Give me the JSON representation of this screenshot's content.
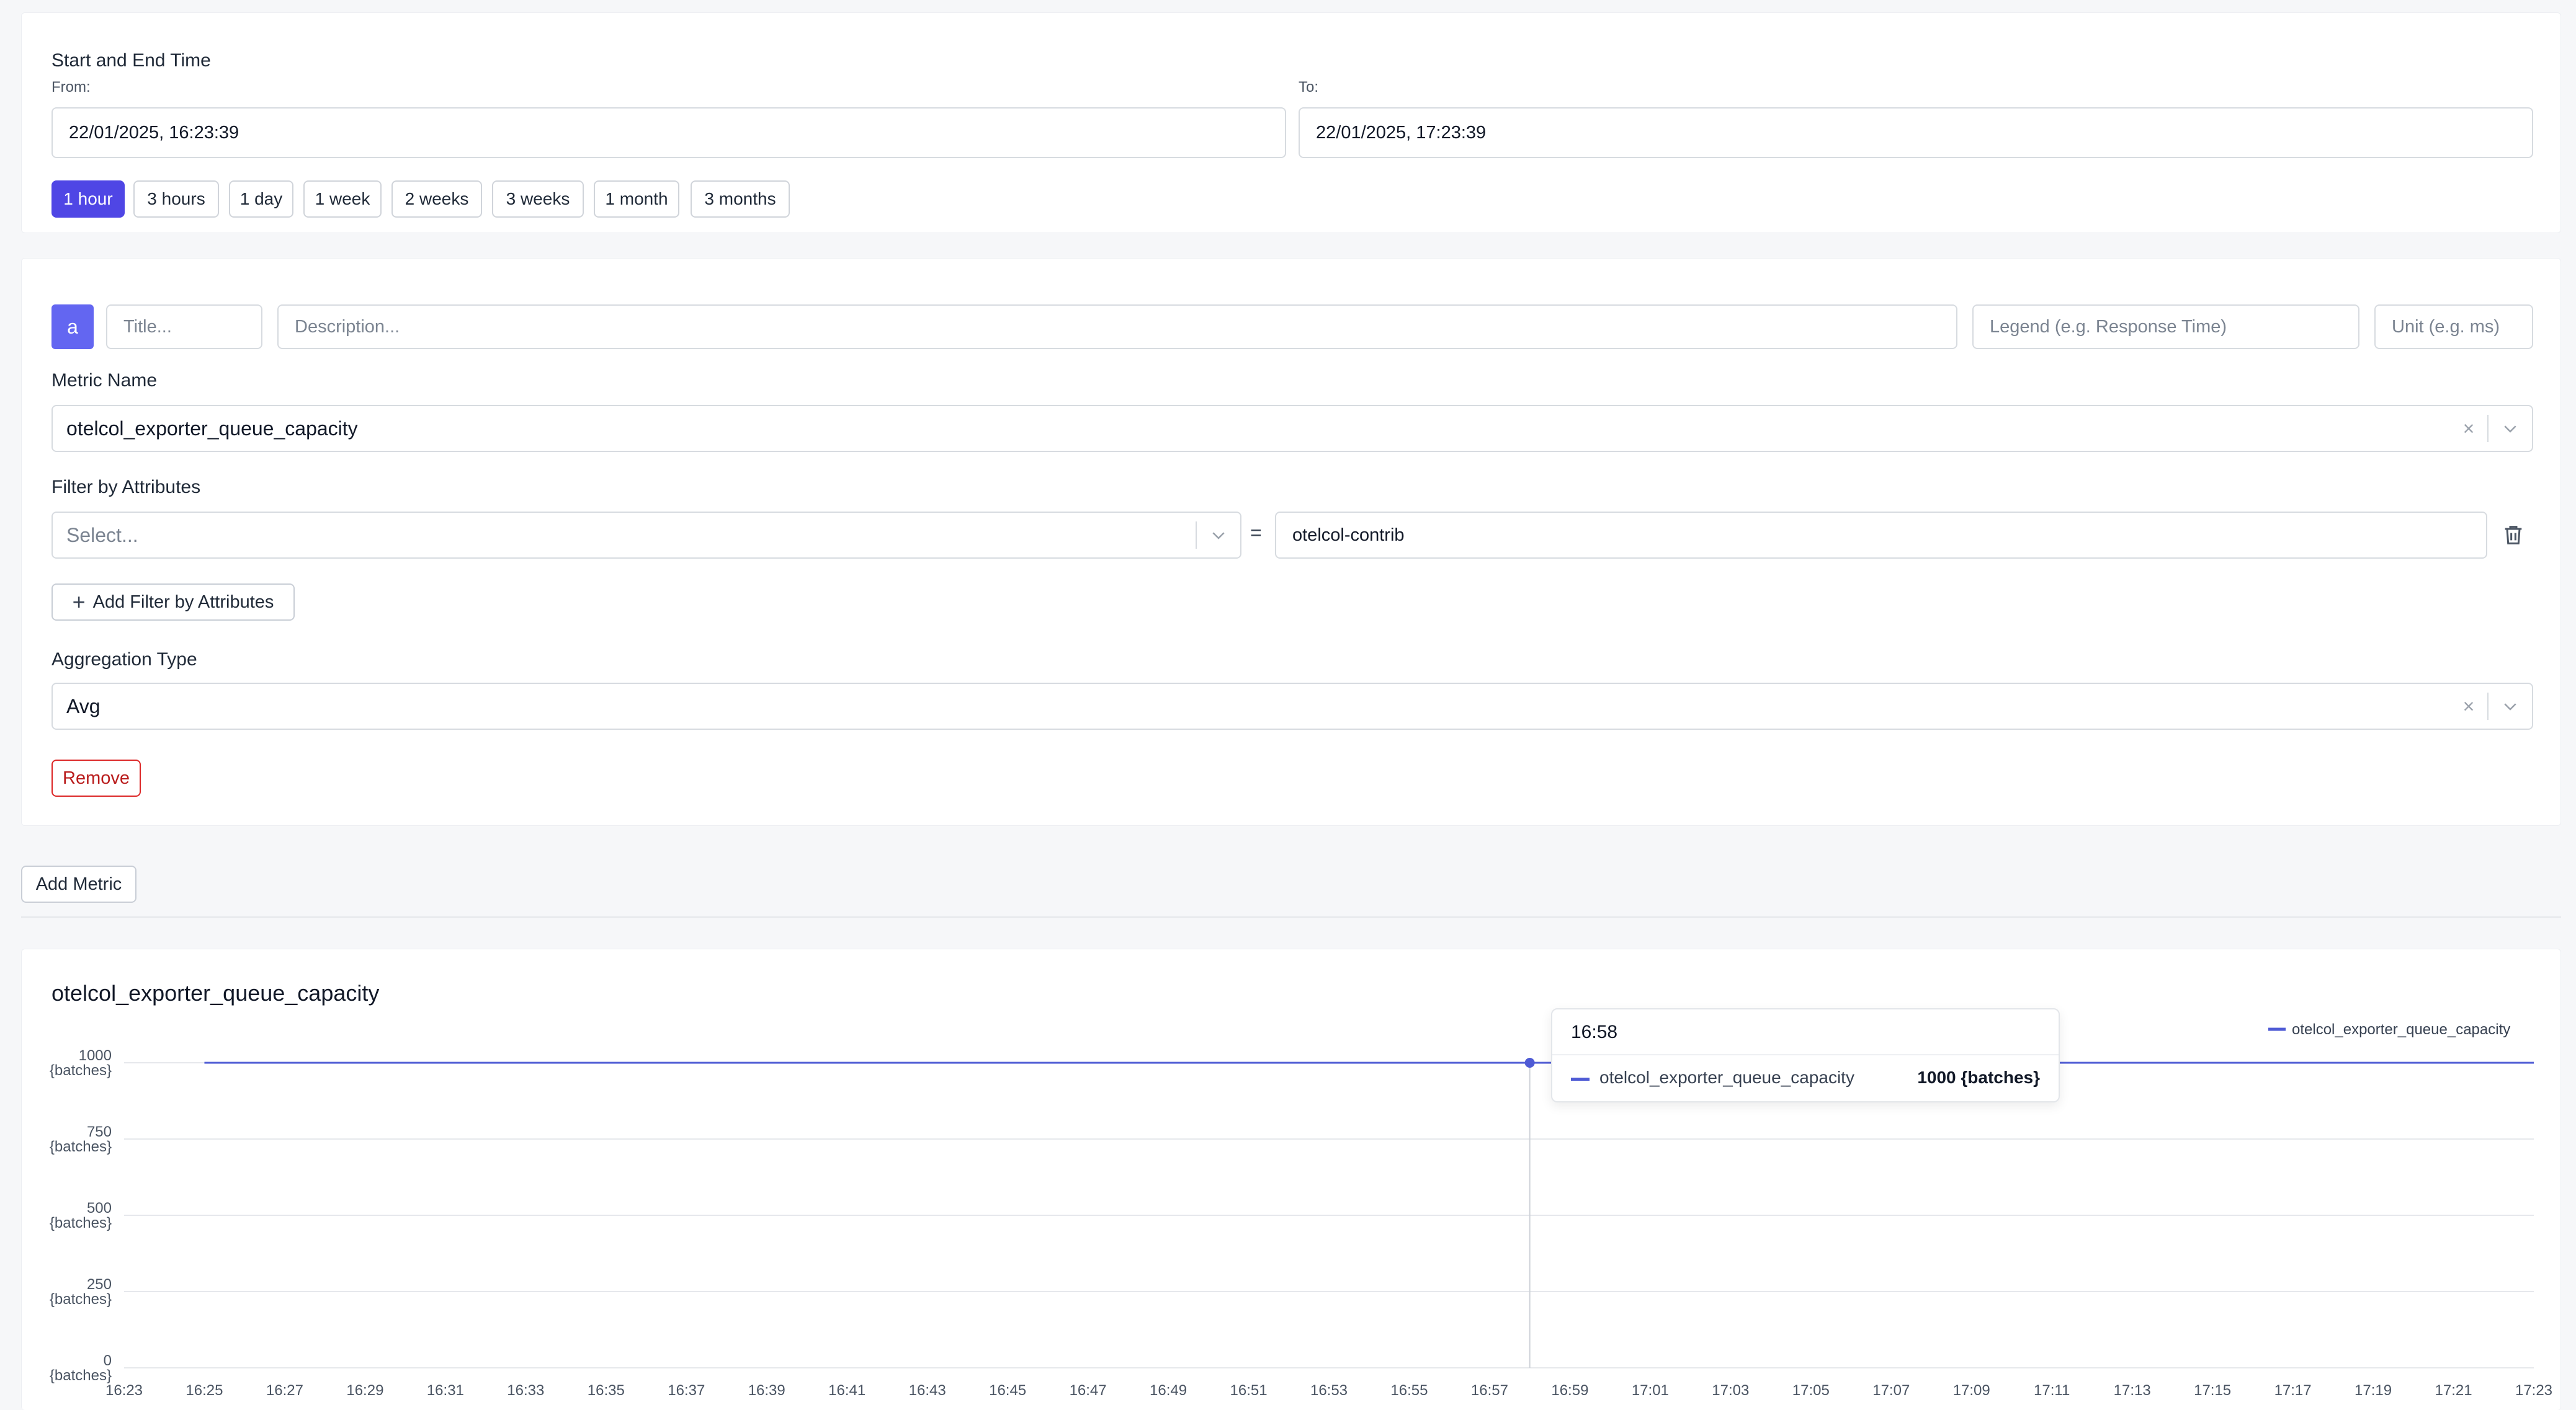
{
  "time_range": {
    "heading": "Start and End Time",
    "from_label": "From:",
    "from_value": "22/01/2025, 16:23:39",
    "to_label": "To:",
    "to_value": "22/01/2025, 17:23:39",
    "quick_ranges": [
      "1 hour",
      "3 hours",
      "1 day",
      "1 week",
      "2 weeks",
      "3 weeks",
      "1 month",
      "3 months"
    ],
    "active_range": "1 hour"
  },
  "query": {
    "badge": "a",
    "title_placeholder": "Title...",
    "description_placeholder": "Description...",
    "legend_placeholder": "Legend (e.g. Response Time)",
    "unit_placeholder": "Unit (e.g. ms)",
    "metric_name_label": "Metric Name",
    "metric_name_value": "otelcol_exporter_queue_capacity",
    "filter_label": "Filter by Attributes",
    "filter_key_placeholder": "Select...",
    "filter_operator": "=",
    "filter_value": "otelcol-contrib",
    "add_filter_label": "Add Filter by Attributes",
    "aggregation_label": "Aggregation Type",
    "aggregation_value": "Avg",
    "remove_label": "Remove"
  },
  "add_metric_label": "Add Metric",
  "chart_data": {
    "type": "line",
    "title": "otelcol_exporter_queue_capacity",
    "xlabel": "",
    "ylabel": "",
    "x": [
      "16:23",
      "16:24",
      "16:25",
      "16:26",
      "16:27",
      "16:28",
      "16:29",
      "16:30",
      "16:31",
      "16:32",
      "16:33",
      "16:34",
      "16:35",
      "16:36",
      "16:37",
      "16:38",
      "16:39",
      "16:40",
      "16:41",
      "16:42",
      "16:43",
      "16:44",
      "16:45",
      "16:46",
      "16:47",
      "16:48",
      "16:49",
      "16:50",
      "16:51",
      "16:52",
      "16:53",
      "16:54",
      "16:55",
      "16:56",
      "16:57",
      "16:58",
      "16:59",
      "17:00",
      "17:01",
      "17:02",
      "17:03",
      "17:04",
      "17:05",
      "17:06",
      "17:07",
      "17:08",
      "17:09",
      "17:10",
      "17:11",
      "17:12",
      "17:13",
      "17:14",
      "17:15",
      "17:16",
      "17:17",
      "17:18",
      "17:19",
      "17:20",
      "17:21",
      "17:22",
      "17:23"
    ],
    "x_tick_labels": [
      "16:23",
      "16:25",
      "16:27",
      "16:29",
      "16:31",
      "16:33",
      "16:35",
      "16:37",
      "16:39",
      "16:41",
      "16:43",
      "16:45",
      "16:47",
      "16:49",
      "16:51",
      "16:53",
      "16:55",
      "16:57",
      "16:59",
      "17:01",
      "17:03",
      "17:05",
      "17:07",
      "17:09",
      "17:11",
      "17:13",
      "17:15",
      "17:17",
      "17:19",
      "17:21",
      "17:23"
    ],
    "series": [
      {
        "name": "otelcol_exporter_queue_capacity",
        "color": "#4f5bd5",
        "start": "16:25",
        "end": "17:23",
        "values": [
          1000,
          1000,
          1000,
          1000,
          1000,
          1000,
          1000,
          1000,
          1000,
          1000,
          1000,
          1000,
          1000,
          1000,
          1000,
          1000,
          1000,
          1000,
          1000,
          1000,
          1000,
          1000,
          1000,
          1000,
          1000,
          1000,
          1000,
          1000,
          1000,
          1000,
          1000,
          1000,
          1000,
          1000,
          1000,
          1000,
          1000,
          1000,
          1000,
          1000,
          1000,
          1000,
          1000,
          1000,
          1000,
          1000,
          1000,
          1000,
          1000,
          1000,
          1000,
          1000,
          1000,
          1000,
          1000,
          1000,
          1000,
          1000,
          1000
        ]
      }
    ],
    "y_ticks": [
      {
        "value": 1000,
        "label": "1000",
        "unit": "{batches}"
      },
      {
        "value": 750,
        "label": "750",
        "unit": "{batches}"
      },
      {
        "value": 500,
        "label": "500",
        "unit": "{batches}"
      },
      {
        "value": 250,
        "label": "250",
        "unit": "{batches}"
      },
      {
        "value": 0,
        "label": "0",
        "unit": "{batches}"
      }
    ],
    "ylim": [
      0,
      1000
    ],
    "grid": true,
    "legend_position": "top-right",
    "tooltip": {
      "time": "16:58",
      "series_name": "otelcol_exporter_queue_capacity",
      "value_text": "1000 {batches}"
    }
  }
}
